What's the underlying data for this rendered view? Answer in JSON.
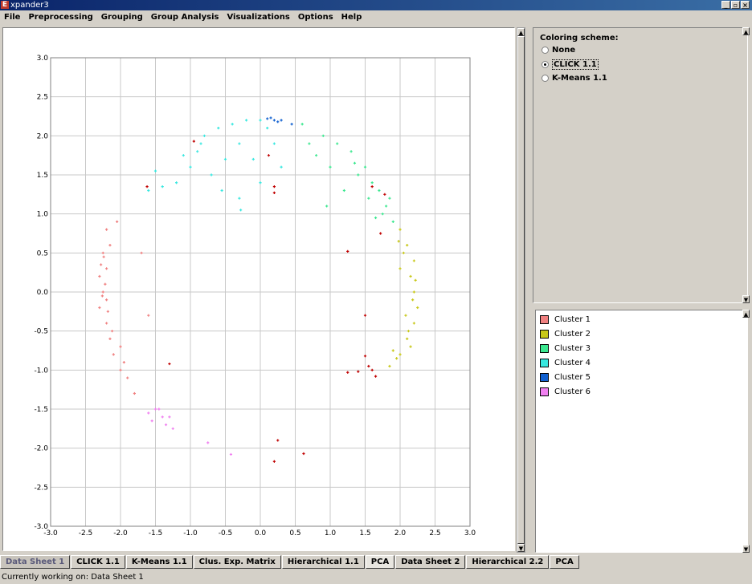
{
  "window": {
    "title": "xpander3",
    "app_icon": "E"
  },
  "menu": [
    "File",
    "Preprocessing",
    "Grouping",
    "Group Analysis",
    "Visualizations",
    "Options",
    "Help"
  ],
  "coloring": {
    "title": "Coloring scheme:",
    "options": [
      "None",
      "CLICK 1.1",
      "K-Means 1.1"
    ],
    "selected": "CLICK 1.1"
  },
  "legend": [
    {
      "label": "Cluster 1",
      "color": "#f08080"
    },
    {
      "label": "Cluster 2",
      "color": "#c8c818"
    },
    {
      "label": "Cluster 3",
      "color": "#3ce890"
    },
    {
      "label": "Cluster 4",
      "color": "#38e8e0"
    },
    {
      "label": "Cluster 5",
      "color": "#1060d0"
    },
    {
      "label": "Cluster 6",
      "color": "#f080f0"
    }
  ],
  "tabs": [
    "Data Sheet 1",
    "CLICK 1.1",
    "K-Means 1.1",
    "Clus. Exp. Matrix",
    "Hierarchical 1.1",
    "PCA",
    "Data Sheet 2",
    "Hierarchical 2.2",
    "PCA"
  ],
  "active_tab": "Data Sheet 1",
  "current_tab": "PCA",
  "status": "Currently working on: Data Sheet 1",
  "chart_data": {
    "type": "scatter",
    "xlim": [
      -3.0,
      3.0
    ],
    "ylim": [
      -3.0,
      3.0
    ],
    "grid": true,
    "xticks": [
      "-3.0",
      "-2.5",
      "-2.0",
      "-1.5",
      "-1.0",
      "-0.5",
      "0.0",
      "0.5",
      "1.0",
      "1.5",
      "2.0",
      "2.5",
      "3.0"
    ],
    "yticks": [
      "3.0",
      "2.5",
      "2.0",
      "1.5",
      "1.0",
      "0.5",
      "0.0",
      "-0.5",
      "-1.0",
      "-1.5",
      "-2.0",
      "-2.5",
      "-3.0"
    ],
    "unclustered_color": "#c00000",
    "series": [
      {
        "color": "#f08080",
        "points": [
          [
            -2.2,
            0.8
          ],
          [
            -2.15,
            0.6
          ],
          [
            -2.25,
            0.5
          ],
          [
            -2.2,
            0.3
          ],
          [
            -2.3,
            0.2
          ],
          [
            -2.25,
            0.0
          ],
          [
            -2.2,
            -0.1
          ],
          [
            -2.3,
            -0.2
          ],
          [
            -2.2,
            -0.4
          ],
          [
            -2.15,
            -0.6
          ],
          [
            -2.1,
            -0.8
          ],
          [
            -2.0,
            -1.0
          ],
          [
            -1.9,
            -1.1
          ],
          [
            -1.8,
            -1.3
          ],
          [
            -2.05,
            0.9
          ],
          [
            -2.28,
            0.35
          ],
          [
            -2.18,
            -0.25
          ],
          [
            -2.12,
            -0.5
          ],
          [
            -2.22,
            0.1
          ],
          [
            -1.95,
            -0.9
          ],
          [
            -1.7,
            0.5
          ],
          [
            -2.0,
            -0.7
          ],
          [
            -1.6,
            -0.3
          ],
          [
            -2.26,
            -0.05
          ],
          [
            -2.24,
            0.45
          ]
        ]
      },
      {
        "color": "#c8c818",
        "points": [
          [
            2.0,
            0.8
          ],
          [
            2.1,
            0.6
          ],
          [
            2.2,
            0.4
          ],
          [
            2.15,
            0.2
          ],
          [
            2.2,
            0.0
          ],
          [
            2.25,
            -0.2
          ],
          [
            2.2,
            -0.4
          ],
          [
            2.1,
            -0.6
          ],
          [
            2.0,
            -0.8
          ],
          [
            1.85,
            -0.95
          ],
          [
            2.05,
            0.5
          ],
          [
            2.18,
            -0.1
          ],
          [
            2.12,
            -0.5
          ],
          [
            1.95,
            -0.85
          ],
          [
            2.0,
            0.3
          ],
          [
            2.22,
            0.15
          ],
          [
            2.08,
            -0.3
          ],
          [
            1.98,
            0.65
          ],
          [
            2.15,
            -0.7
          ],
          [
            1.9,
            -0.75
          ]
        ]
      },
      {
        "color": "#3ce890",
        "points": [
          [
            0.6,
            2.15
          ],
          [
            0.9,
            2.0
          ],
          [
            1.1,
            1.9
          ],
          [
            1.3,
            1.8
          ],
          [
            1.5,
            1.6
          ],
          [
            1.6,
            1.4
          ],
          [
            1.7,
            1.3
          ],
          [
            1.8,
            1.1
          ],
          [
            1.9,
            0.9
          ],
          [
            1.4,
            1.5
          ],
          [
            1.2,
            1.3
          ],
          [
            1.0,
            1.6
          ],
          [
            0.7,
            1.9
          ],
          [
            1.55,
            1.2
          ],
          [
            1.75,
            1.0
          ],
          [
            0.8,
            1.75
          ],
          [
            1.35,
            1.65
          ],
          [
            1.65,
            0.95
          ],
          [
            1.85,
            1.2
          ],
          [
            0.95,
            1.1
          ]
        ]
      },
      {
        "color": "#38e8e0",
        "points": [
          [
            -0.8,
            2.0
          ],
          [
            -0.6,
            2.1
          ],
          [
            -0.4,
            2.15
          ],
          [
            -0.2,
            2.2
          ],
          [
            0.0,
            2.2
          ],
          [
            0.1,
            2.1
          ],
          [
            -0.9,
            1.8
          ],
          [
            -1.0,
            1.6
          ],
          [
            -1.2,
            1.4
          ],
          [
            -1.4,
            1.35
          ],
          [
            -1.6,
            1.3
          ],
          [
            -0.5,
            1.7
          ],
          [
            -0.3,
            1.9
          ],
          [
            -0.7,
            1.5
          ],
          [
            0.0,
            1.4
          ],
          [
            -0.3,
            1.2
          ],
          [
            -0.28,
            1.05
          ],
          [
            0.2,
            1.9
          ],
          [
            -0.1,
            1.7
          ],
          [
            -1.1,
            1.75
          ],
          [
            -1.5,
            1.55
          ],
          [
            -0.55,
            1.3
          ],
          [
            0.3,
            1.6
          ],
          [
            -0.85,
            1.9
          ]
        ]
      },
      {
        "color": "#1060d0",
        "points": [
          [
            0.1,
            2.22
          ],
          [
            0.2,
            2.2
          ],
          [
            0.3,
            2.2
          ],
          [
            0.15,
            2.23
          ],
          [
            0.45,
            2.15
          ],
          [
            0.25,
            2.18
          ]
        ]
      },
      {
        "color": "#f080f0",
        "points": [
          [
            -1.5,
            -1.5
          ],
          [
            -1.4,
            -1.6
          ],
          [
            -1.3,
            -1.6
          ],
          [
            -1.6,
            -1.55
          ],
          [
            -1.35,
            -1.7
          ],
          [
            -1.25,
            -1.75
          ],
          [
            -1.45,
            -1.5
          ],
          [
            -1.55,
            -1.65
          ],
          [
            -0.75,
            -1.93
          ],
          [
            -0.42,
            -2.08
          ]
        ]
      }
    ],
    "unclustered": [
      [
        -1.3,
        -0.92
      ],
      [
        -1.62,
        1.35
      ],
      [
        -0.95,
        1.93
      ],
      [
        0.12,
        1.75
      ],
      [
        0.2,
        1.35
      ],
      [
        0.2,
        1.27
      ],
      [
        1.25,
        0.52
      ],
      [
        1.6,
        1.35
      ],
      [
        1.72,
        0.75
      ],
      [
        1.5,
        -0.82
      ],
      [
        1.55,
        -0.95
      ],
      [
        1.6,
        -1.0
      ],
      [
        1.4,
        -1.02
      ],
      [
        1.25,
        -1.03
      ],
      [
        1.65,
        -1.08
      ],
      [
        1.5,
        -0.3
      ],
      [
        0.25,
        -1.9
      ],
      [
        0.2,
        -2.17
      ],
      [
        0.62,
        -2.07
      ],
      [
        1.78,
        1.25
      ]
    ]
  }
}
